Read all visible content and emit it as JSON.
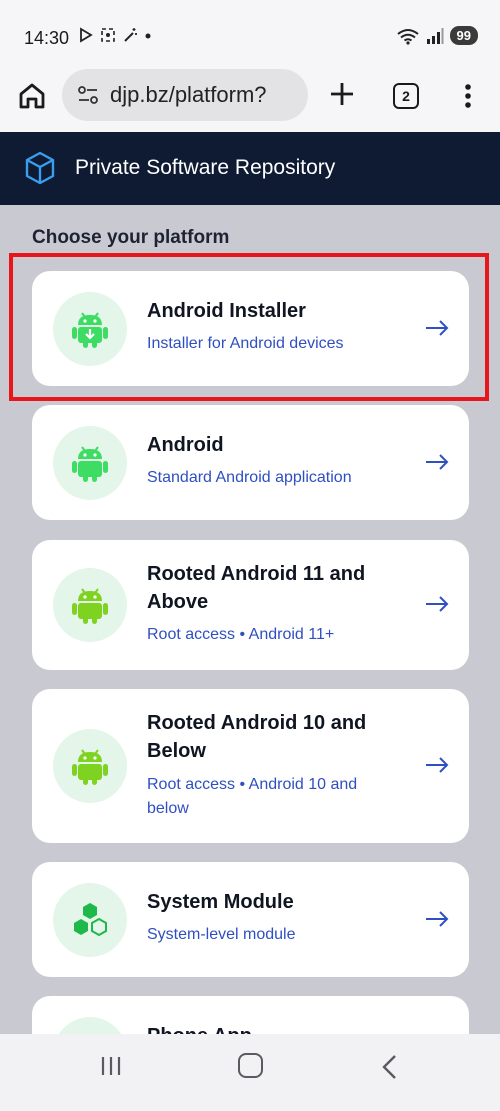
{
  "status_bar": {
    "time": "14:30",
    "battery": "99"
  },
  "browser": {
    "url": "djp.bz/platform?",
    "tab_count": "2"
  },
  "header": {
    "title": "Private Software Repository"
  },
  "section": {
    "title": "Choose your platform"
  },
  "cards": [
    {
      "title": "Android Installer",
      "subtitle": "Installer for Android devices",
      "icon": "android-installer-icon"
    },
    {
      "title": "Android",
      "subtitle": "Standard Android application",
      "icon": "android-icon"
    },
    {
      "title": "Rooted Android 11 and Above",
      "subtitle": "Root access • Android 11+",
      "icon": "android-icon"
    },
    {
      "title": "Rooted Android 10 and Below",
      "subtitle": "Root access • Android 10 and below",
      "icon": "android-icon"
    },
    {
      "title": "System Module",
      "subtitle": "System-level module",
      "icon": "hexagons-icon"
    },
    {
      "title": "Phone App",
      "subtitle": "",
      "icon": "phone-icon"
    }
  ],
  "colors": {
    "header_bg": "#0f1b33",
    "accent_blue": "#2f4fc2",
    "android_green": "#3ddc63",
    "highlight_red": "#e8161b",
    "content_bg": "#c9c9d1"
  }
}
